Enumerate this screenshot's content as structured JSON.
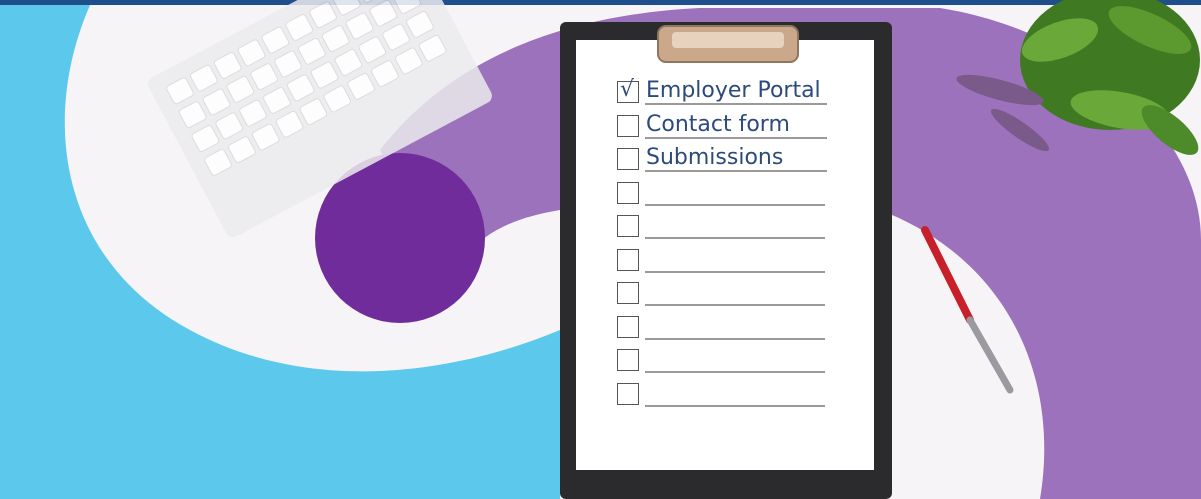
{
  "checklist": {
    "items": [
      {
        "label": "Employer Portal",
        "checked": true
      },
      {
        "label": "Contact form",
        "checked": false
      },
      {
        "label": "Submissions",
        "checked": false
      },
      {
        "label": "",
        "checked": false
      },
      {
        "label": "",
        "checked": false
      },
      {
        "label": "",
        "checked": false
      },
      {
        "label": "",
        "checked": false
      },
      {
        "label": "",
        "checked": false
      },
      {
        "label": "",
        "checked": false
      },
      {
        "label": "",
        "checked": false
      }
    ]
  },
  "colors": {
    "cyan": "#5cc9ec",
    "purple": "#9b72bb",
    "deep_purple": "#6f2c9a",
    "clipboard": "#2b2b2e",
    "ink": "#2c4a7a"
  }
}
